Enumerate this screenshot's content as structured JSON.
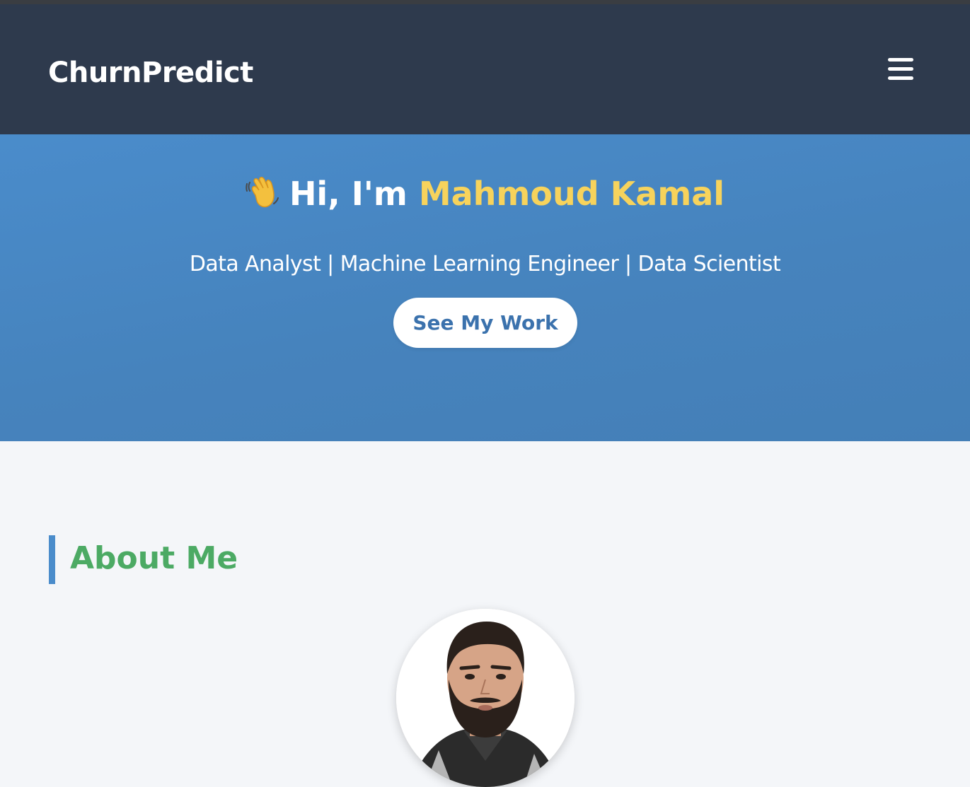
{
  "navbar": {
    "brand": "ChurnPredict",
    "menu_icon": "hamburger-menu-icon"
  },
  "hero": {
    "wave_emoji": "👋",
    "greeting": "Hi, I'm ",
    "name": "Mahmoud Kamal",
    "subtitle": "Data Analyst | Machine Learning Engineer | Data Scientist",
    "cta_label": "See My Work"
  },
  "about": {
    "title": "About Me",
    "avatar": "profile-photo"
  },
  "colors": {
    "navbar_bg": "#2e3a4d",
    "hero_bg": "#4a8ccb",
    "name_accent": "#f7d35c",
    "cta_text": "#3b72ad",
    "section_title": "#4caa64",
    "section_bar": "#4a8ccb",
    "page_bg": "#f4f6f9"
  }
}
